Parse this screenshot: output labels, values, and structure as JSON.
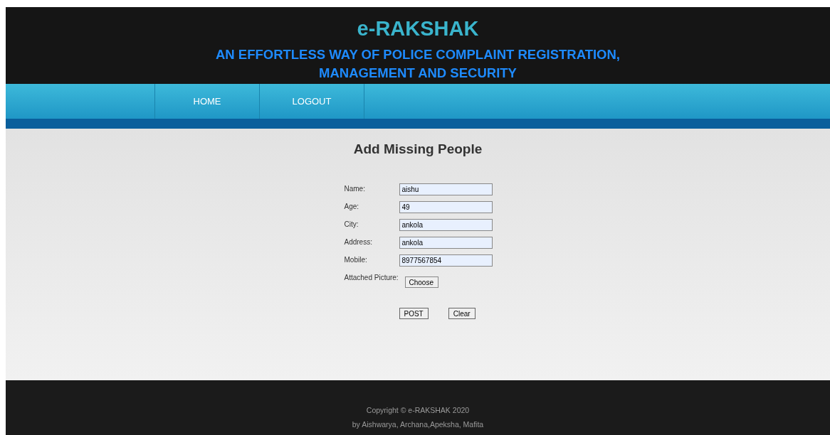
{
  "header": {
    "logo": "e-RAKSHAK",
    "tagline_lines": [
      "AN EFFORTLESS WAY OF POLICE COMPLAINT REGISTRATION,",
      "MANAGEMENT AND SECURITY"
    ]
  },
  "nav": {
    "items": [
      {
        "label": "HOME"
      },
      {
        "label": "LOGOUT"
      }
    ]
  },
  "form": {
    "title": "Add Missing People",
    "fields": [
      {
        "kind": "text",
        "label": "Name:",
        "value": "aishu"
      },
      {
        "kind": "text",
        "label": "Age:",
        "value": "49"
      },
      {
        "kind": "text",
        "label": "City:",
        "value": "ankola"
      },
      {
        "kind": "text",
        "label": "Address:",
        "value": "ankola"
      },
      {
        "kind": "text",
        "label": "Mobile:",
        "value": "8977567854"
      },
      {
        "kind": "file",
        "label": "Attached Picture:",
        "button": "Choose"
      }
    ],
    "buttons": [
      "POST",
      "Clear"
    ]
  },
  "footer": {
    "lines": [
      "Copyright © e-RAKSHAK 2020",
      "by Aishwarya, Archana,Apeksha, Mafita"
    ]
  }
}
